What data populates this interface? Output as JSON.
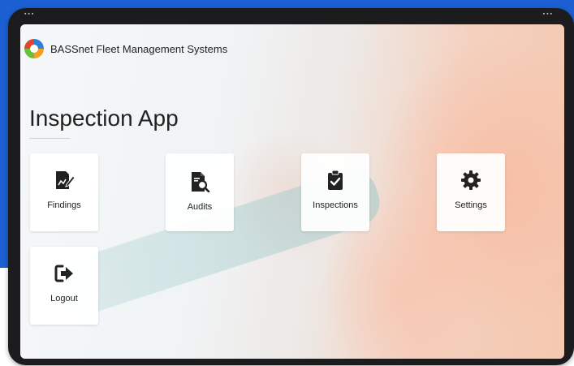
{
  "brand": {
    "name": "BASSnet Fleet Management Systems",
    "logo_icon": "bassnet-logo-icon"
  },
  "page": {
    "title": "Inspection App"
  },
  "menu": {
    "items": [
      {
        "label": "Findings",
        "icon": "edit-document-icon"
      },
      {
        "label": "Audits",
        "icon": "search-document-icon"
      },
      {
        "label": "Inspections",
        "icon": "clipboard-check-icon"
      },
      {
        "label": "Settings",
        "icon": "gear-icon"
      },
      {
        "label": "Logout",
        "icon": "sign-out-icon"
      }
    ]
  },
  "colors": {
    "backdrop": "#1b5fd3",
    "device_frame": "#1c1c1e",
    "icon": "#222222"
  }
}
